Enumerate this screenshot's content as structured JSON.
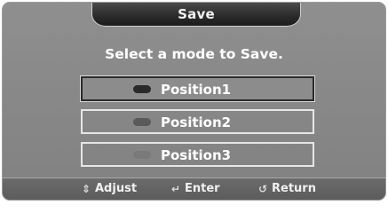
{
  "dialog": {
    "title": "Save",
    "prompt": "Select a mode to Save."
  },
  "options": [
    {
      "label": "Position1",
      "selected": true,
      "indicator_color": "#2a2a2a"
    },
    {
      "label": "Position2",
      "selected": false,
      "indicator_color": "#5a5a5a"
    },
    {
      "label": "Position3",
      "selected": false,
      "indicator_color": "#7a7a7a"
    }
  ],
  "footer": {
    "adjust": "Adjust",
    "enter": "Enter",
    "return": "Return"
  },
  "icons": {
    "adjust": "up-down-arrows-icon",
    "enter": "enter-icon",
    "return": "return-icon"
  }
}
